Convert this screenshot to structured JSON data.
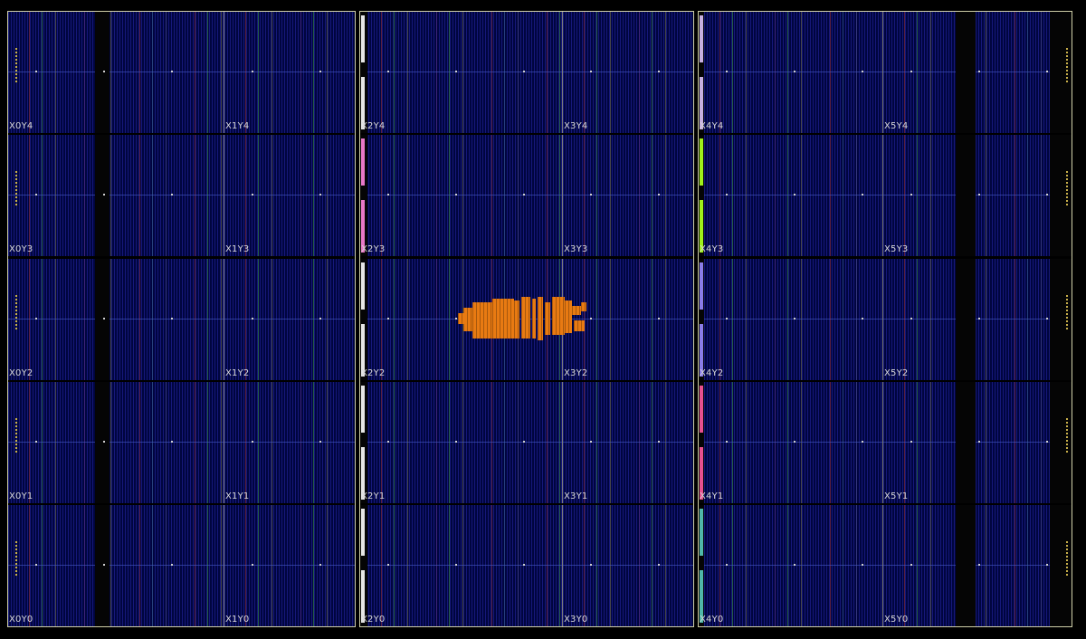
{
  "device_view": {
    "clock_regions": [
      {
        "label": "X0Y4"
      },
      {
        "label": "X1Y4"
      },
      {
        "label": "X2Y4"
      },
      {
        "label": "X3Y4"
      },
      {
        "label": "X4Y4"
      },
      {
        "label": "X5Y4"
      },
      {
        "label": "X0Y3"
      },
      {
        "label": "X1Y3"
      },
      {
        "label": "X2Y3"
      },
      {
        "label": "X3Y3"
      },
      {
        "label": "X4Y3"
      },
      {
        "label": "X5Y3"
      },
      {
        "label": "X0Y2"
      },
      {
        "label": "X1Y2"
      },
      {
        "label": "X2Y2"
      },
      {
        "label": "X3Y2"
      },
      {
        "label": "X4Y2"
      },
      {
        "label": "X5Y2"
      },
      {
        "label": "X0Y1"
      },
      {
        "label": "X1Y1"
      },
      {
        "label": "X2Y1"
      },
      {
        "label": "X3Y1"
      },
      {
        "label": "X4Y1"
      },
      {
        "label": "X5Y1"
      },
      {
        "label": "X0Y0"
      },
      {
        "label": "X1Y0"
      },
      {
        "label": "X2Y0"
      },
      {
        "label": "X3Y0"
      },
      {
        "label": "X4Y0"
      },
      {
        "label": "X5Y0"
      }
    ],
    "colors": {
      "background": "#000000",
      "fabric": "#00053f",
      "group_border": "#cfcfa8",
      "placed_cells": "#e87a12",
      "label_text": "#d8d8d8",
      "io_column_X4Y3": "#9ef01a",
      "io_column_X4Y2": "#8a7ce8",
      "io_column_X4Y1": "#e8508f",
      "io_column_X4Y0": "#4fb8a8",
      "io_column_X2Y3": "#e878c8"
    }
  }
}
